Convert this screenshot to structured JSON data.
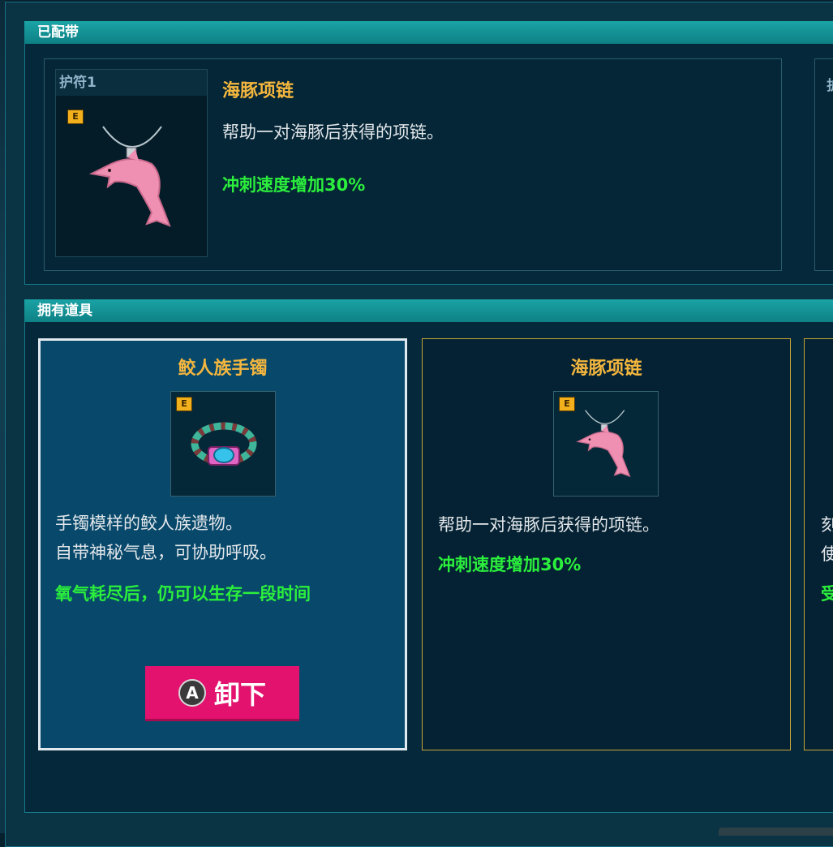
{
  "equipped_section": {
    "header": "已配带",
    "slot_label": "护符1",
    "slot_label_2": "护",
    "rank": "E",
    "item_name": "海豚项链",
    "description": "帮助一对海豚后获得的项链。",
    "effect": "冲刺速度增加30%"
  },
  "owned_section": {
    "header": "拥有道具",
    "items": [
      {
        "name": "鲛人族手镯",
        "rank": "E",
        "icon": "bracelet-icon",
        "description_line1": "手镯模样的鲛人族遗物。",
        "description_line2": "自带神秘气息，可协助呼吸。",
        "effect": "氧气耗尽后，仍可以生存一段时间"
      },
      {
        "name": "海豚项链",
        "rank": "E",
        "icon": "dolphin-necklace-icon",
        "description_line1": "帮助一对海豚后获得的项链。",
        "effect": "冲刺速度增加30%"
      },
      {
        "desc_char1": "刻",
        "desc_char2": "使",
        "effect_char": "受"
      }
    ],
    "action_button": {
      "button_glyph": "A",
      "label": "卸下"
    }
  },
  "colors": {
    "header_teal": "#1aa3a5",
    "item_name_gold": "#f4b63e",
    "effect_green": "#2bef3c",
    "unequip_pink": "#e2126e"
  }
}
